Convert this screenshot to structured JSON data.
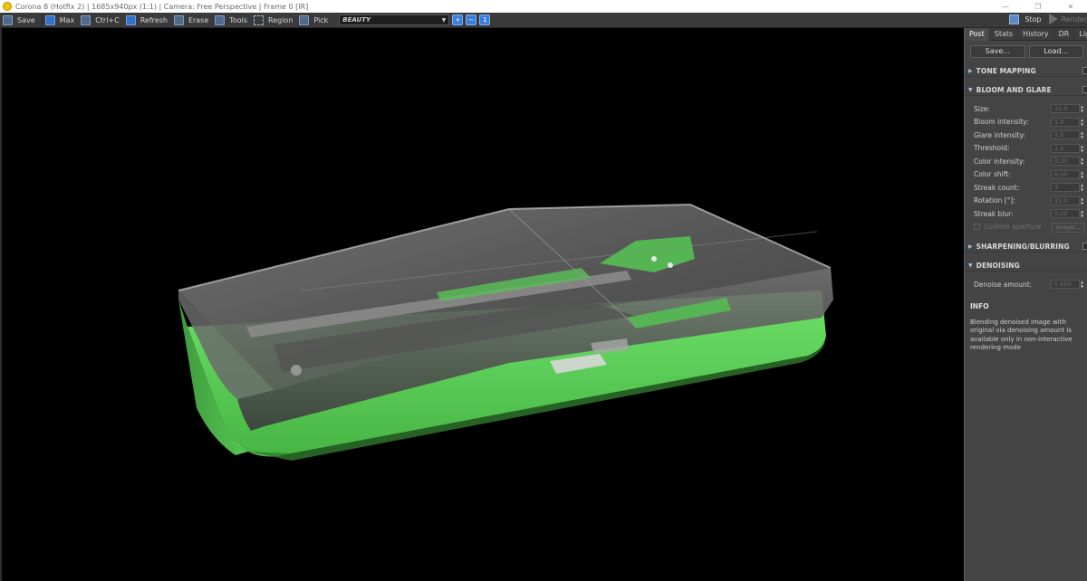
{
  "window": {
    "title": "Corona 8 (Hotfix 2) | 1685x940px (1:1) | Camera: Free Perspective | Frame 0 [IR]",
    "controls": [
      "—",
      "❐",
      "✕"
    ]
  },
  "toolbar": {
    "save": "Save",
    "max": "Max",
    "copy": "Ctrl+C",
    "refresh": "Refresh",
    "erase": "Erase",
    "tools": "Tools",
    "region": "Region",
    "pick": "Pick",
    "pass": "BEAUTY",
    "zoom_in": "+",
    "zoom_out": "−",
    "zoom_fit": "1",
    "stop": "Stop",
    "render": "Render"
  },
  "panel": {
    "tabs": [
      "Post",
      "Stats",
      "History",
      "DR",
      "LightMix"
    ],
    "active_tab": "Post",
    "save_btn": "Save...",
    "load_btn": "Load...",
    "sections": {
      "tone_mapping": "TONE MAPPING",
      "bloom_glare": "BLOOM AND GLARE",
      "sharpening": "SHARPENING/BLURRING",
      "denoising": "DENOISING"
    },
    "bloom_rows": [
      {
        "label": "Size:",
        "value": "15.0"
      },
      {
        "label": "Bloom intensity:",
        "value": "1.0"
      },
      {
        "label": "Glare intensity:",
        "value": "1.0"
      },
      {
        "label": "Threshold:",
        "value": "1.0"
      },
      {
        "label": "Color intensity:",
        "value": "0.30"
      },
      {
        "label": "Color shift:",
        "value": "0.50"
      },
      {
        "label": "Streak count:",
        "value": "3"
      },
      {
        "label": "Rotation [°]:",
        "value": "15.0"
      },
      {
        "label": "Streak blur:",
        "value": "0.20"
      }
    ],
    "custom_aperture": "Custom aperture",
    "aperture_btn": "Image...",
    "denoise_label": "Denoise amount:",
    "denoise_value": "0.650",
    "info_title": "INFO",
    "info_text": "Blending denoised image with original via denoising amount is available only in non-interactive rendering mode"
  },
  "colors": {
    "accent": "#3a7fd9",
    "case_green": "#5fd25c",
    "panel_bg": "#444444",
    "viewport_bg": "#000000"
  }
}
